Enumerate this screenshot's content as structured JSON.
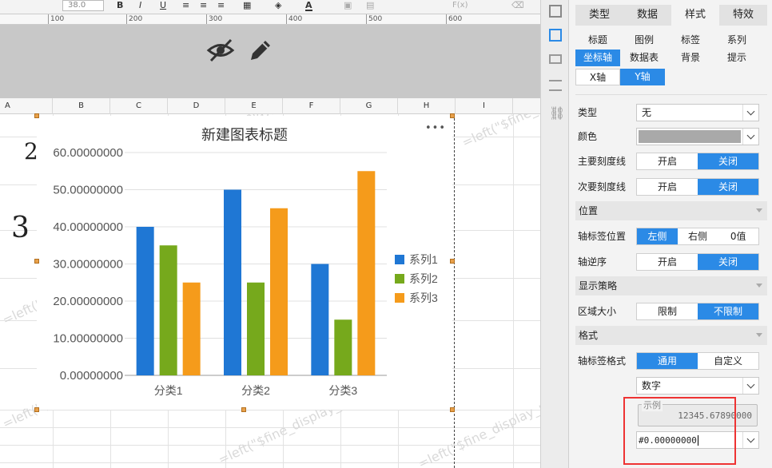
{
  "toolbar": {
    "font_size": "38.0"
  },
  "ruler": {
    "marks": [
      "100",
      "200",
      "300",
      "400",
      "500",
      "600"
    ]
  },
  "columns": [
    "A",
    "B",
    "C",
    "D",
    "E",
    "F",
    "G",
    "H",
    "I"
  ],
  "sheet_cells": {
    "left_digit_1": "2",
    "left_digit_2": "3"
  },
  "watermark": "=left(\"$fine_display_name\")-1",
  "chart": {
    "more_label": "•••"
  },
  "chart_data": {
    "type": "bar",
    "title": "新建图表标题",
    "categories": [
      "分类1",
      "分类2",
      "分类3"
    ],
    "series": [
      {
        "name": "系列1",
        "color": "#1f77d4",
        "values": [
          40,
          50,
          30
        ]
      },
      {
        "name": "系列2",
        "color": "#76a91c",
        "values": [
          35,
          25,
          15
        ]
      },
      {
        "name": "系列3",
        "color": "#f59b1b",
        "values": [
          25,
          45,
          55
        ]
      }
    ],
    "y_ticks": [
      "0.00000000",
      "10.00000000",
      "20.00000000",
      "30.00000000",
      "40.00000000",
      "50.00000000",
      "60.00000000"
    ],
    "ylim": [
      0,
      60
    ],
    "legend_position": "right",
    "grid": true
  },
  "panel": {
    "tabs": [
      "类型",
      "数据",
      "样式",
      "特效"
    ],
    "active_tab": "样式",
    "subtabs_row1": [
      "标题",
      "图例",
      "标签",
      "系列"
    ],
    "subtabs_row2": [
      "坐标轴",
      "数据表",
      "背景",
      "提示"
    ],
    "axis_tabs": [
      "X轴",
      "Y轴"
    ],
    "type_label": "类型",
    "type_value": "无",
    "color_label": "颜色",
    "major_tick_label": "主要刻度线",
    "minor_tick_label": "次要刻度线",
    "on": "开启",
    "off": "关闭",
    "position_section": "位置",
    "axis_label_pos_label": "轴标签位置",
    "pos_options": [
      "左侧",
      "右侧",
      "0值"
    ],
    "reverse_label": "轴逆序",
    "display_section": "显示策略",
    "area_size_label": "区域大小",
    "limit": "限制",
    "no_limit": "不限制",
    "format_section": "格式",
    "axis_format_label": "轴标签格式",
    "general": "通用",
    "custom": "自定义",
    "number_type": "数字",
    "example_title": "示例",
    "example_value": "12345.67890000",
    "format_value": "#0.00000000"
  }
}
